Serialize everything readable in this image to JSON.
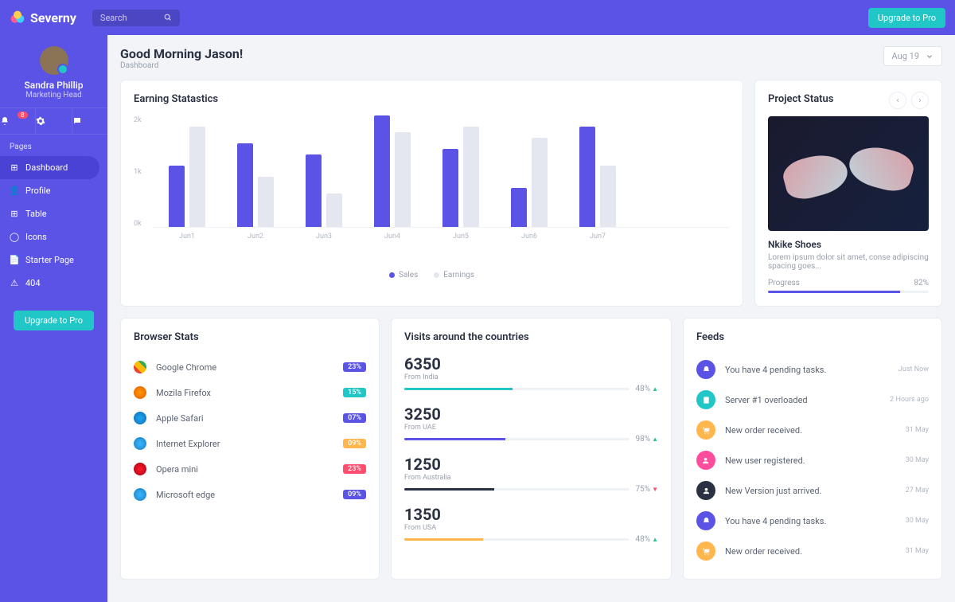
{
  "brand": "Severny",
  "search": {
    "placeholder": "Search"
  },
  "header": {
    "upgrade": "Upgrade to Pro"
  },
  "user": {
    "name": "Sandra Phillip",
    "role": "Marketing Head",
    "notif_badge": "8"
  },
  "sidebar": {
    "section": "Pages",
    "items": [
      {
        "label": "Dashboard"
      },
      {
        "label": "Profile"
      },
      {
        "label": "Table"
      },
      {
        "label": "Icons"
      },
      {
        "label": "Starter Page"
      },
      {
        "label": "404"
      }
    ],
    "upgrade": "Upgrade to Pro"
  },
  "page": {
    "title": "Good Morning Jason!",
    "breadcrumb": "Dashboard",
    "date": "Aug 19"
  },
  "earning": {
    "title": "Earning Statastics",
    "legend": {
      "a": "Sales",
      "b": "Earnings"
    }
  },
  "chart_data": {
    "type": "bar",
    "title": "Earning Statastics",
    "xlabel": "",
    "ylabel": "",
    "ylim": [
      0,
      2
    ],
    "y_ticks": [
      "2k",
      "1k",
      "0k"
    ],
    "categories": [
      "Jun1",
      "Jun2",
      "Jun3",
      "Jun4",
      "Jun5",
      "Jun6",
      "Jun7"
    ],
    "series": [
      {
        "name": "Sales",
        "values": [
          1.1,
          1.5,
          1.3,
          2.0,
          1.4,
          0.7,
          1.8
        ]
      },
      {
        "name": "Earnings",
        "values": [
          1.8,
          0.9,
          0.6,
          1.7,
          1.8,
          1.6,
          1.1
        ]
      }
    ]
  },
  "project": {
    "title": "Project Status",
    "name": "Nkike Shoes",
    "desc": "Lorem ipsum dolor sit amet, conse adipiscing spacing goes...",
    "progress_label": "Progress",
    "progress_pct": "82%"
  },
  "browser": {
    "title": "Browser Stats",
    "items": [
      {
        "name": "Google Chrome",
        "pct": "23%",
        "color": "#5a53e6",
        "icon": "linear-gradient(45deg,#ea4335 0 33%,#fbbc05 33% 66%,#34a853 66%)"
      },
      {
        "name": "Mozila Firefox",
        "pct": "15%",
        "color": "#21c6c6",
        "icon": "radial-gradient(circle,#ff9500,#e66000)"
      },
      {
        "name": "Apple Safari",
        "pct": "07%",
        "color": "#5a53e6",
        "icon": "radial-gradient(circle,#1fa8f4,#0d6bb5)"
      },
      {
        "name": "Internet Explorer",
        "pct": "09%",
        "color": "#ffb64d",
        "icon": "radial-gradient(circle,#38b6ff,#1e7fc2)"
      },
      {
        "name": "Opera mini",
        "pct": "23%",
        "color": "#ff4d6d",
        "icon": "radial-gradient(circle,#ff1b2d,#a30010)"
      },
      {
        "name": "Microsoft edge",
        "pct": "09%",
        "color": "#5a53e6",
        "icon": "radial-gradient(circle,#38b6ff,#1e7fc2)"
      }
    ]
  },
  "visits": {
    "title": "Visits around the countries",
    "items": [
      {
        "num": "6350",
        "from": "From India",
        "pct": "48%",
        "dir": "up",
        "color": "#21c6c6",
        "fill": 48
      },
      {
        "num": "3250",
        "from": "From UAE",
        "pct": "98%",
        "dir": "up",
        "color": "#5a53e6",
        "fill": 45
      },
      {
        "num": "1250",
        "from": "From Australia",
        "pct": "75%",
        "dir": "down",
        "color": "#2a3142",
        "fill": 40
      },
      {
        "num": "1350",
        "from": "From USA",
        "pct": "48%",
        "dir": "up",
        "color": "#ffb64d",
        "fill": 35
      }
    ]
  },
  "feeds": {
    "title": "Feeds",
    "items": [
      {
        "text": "You have 4 pending tasks.",
        "time": "Just Now",
        "icon": "bell",
        "color": "#5a53e6"
      },
      {
        "text": "Server #1 overloaded",
        "time": "2 Hours ago",
        "icon": "file",
        "color": "#21c6c6"
      },
      {
        "text": "New order received.",
        "time": "31 May",
        "icon": "cart",
        "color": "#ffb64d"
      },
      {
        "text": "New user registered.",
        "time": "30 May",
        "icon": "user-add",
        "color": "#ff4d9d"
      },
      {
        "text": "New Version just arrived.",
        "time": "27 May",
        "icon": "user",
        "color": "#2a3142"
      },
      {
        "text": "You have 4 pending tasks.",
        "time": "30 May",
        "icon": "bell",
        "color": "#5a53e6"
      },
      {
        "text": "New order received.",
        "time": "31 May",
        "icon": "cart",
        "color": "#ffb64d"
      }
    ]
  }
}
